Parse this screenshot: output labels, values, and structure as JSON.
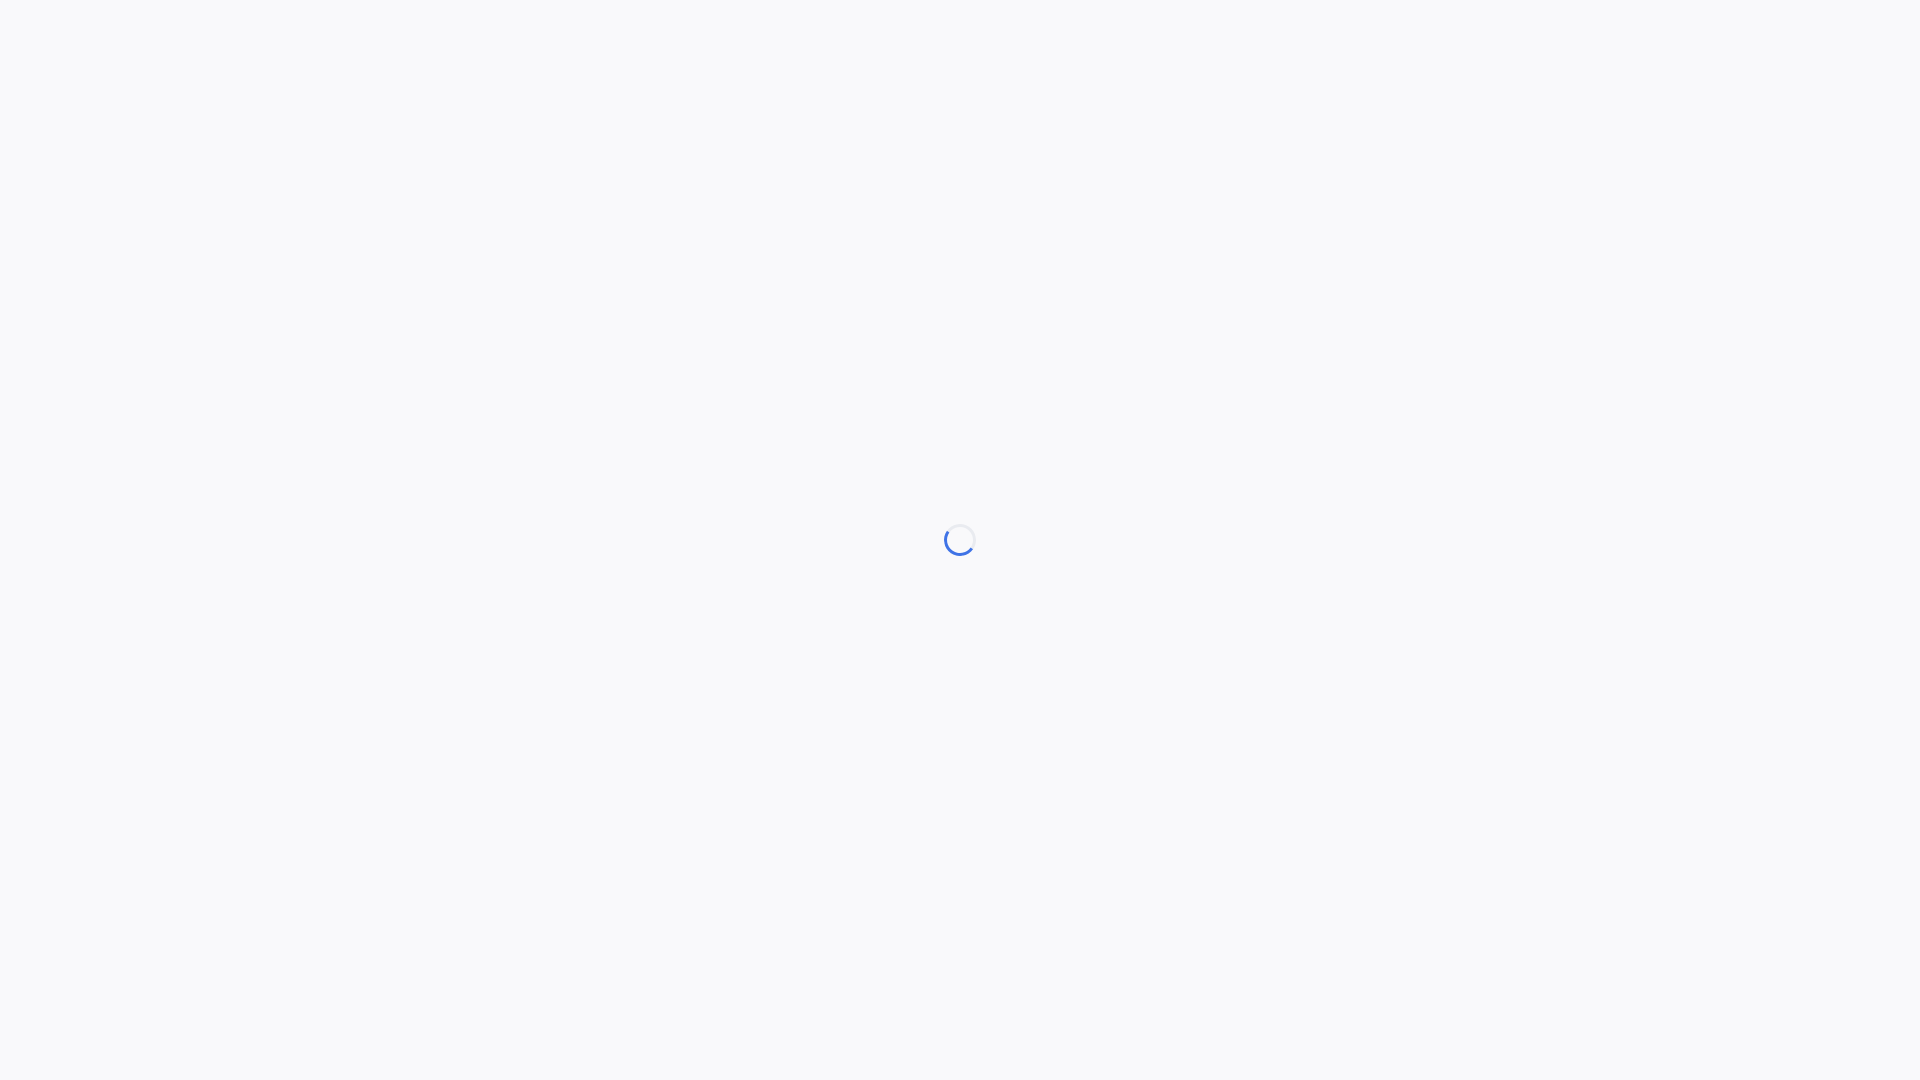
{
  "page": {
    "background_color": "#f9f9fb"
  },
  "loading": {
    "icon": "loading-spinner-icon",
    "accent_color": "#3f73e6",
    "track_color": "#e9ebf0"
  }
}
